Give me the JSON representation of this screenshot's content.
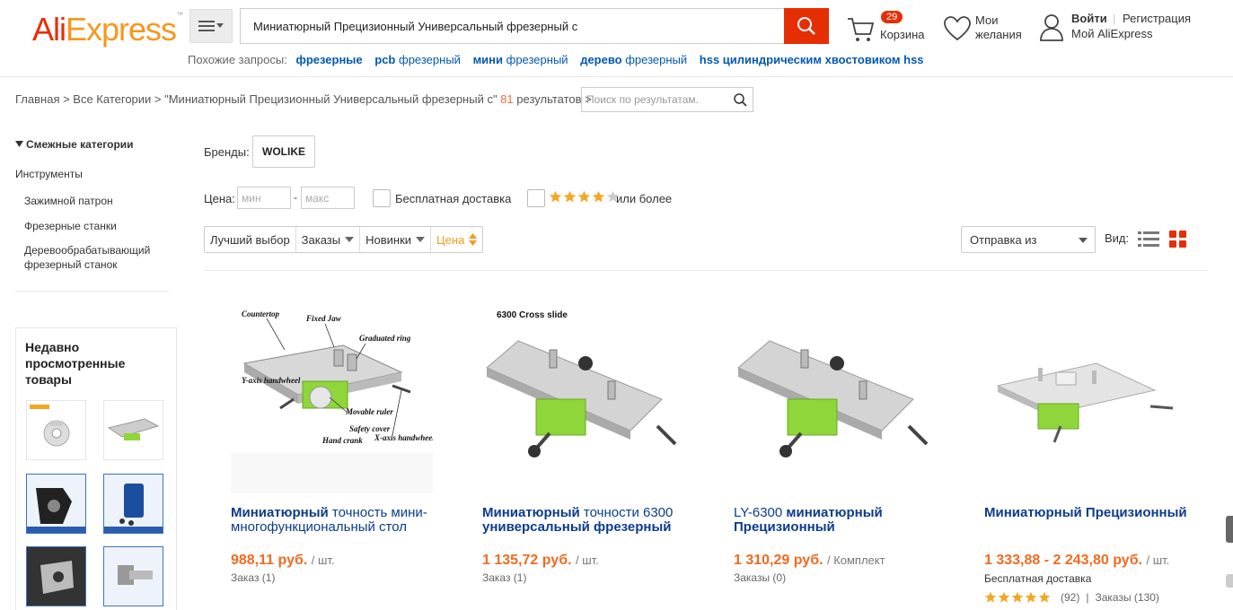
{
  "header": {
    "logo_part1": "Ali",
    "logo_part2": "Express",
    "search_query": "Миниатюрный Прецизионный Универсальный фрезерный с",
    "cart_count": "29",
    "cart_label": "Корзина",
    "wishlist_label": "Мои желания",
    "signin_label": "Войти",
    "register_label": "Регистрация",
    "my_account_label": "Мой AliExpress",
    "related_label": "Похожие запросы:",
    "related_queries": [
      {
        "bold": "фрезерные",
        "rest": ""
      },
      {
        "bold": "pcb",
        "rest": " фрезерный"
      },
      {
        "bold": "мини",
        "rest": " фрезерный"
      },
      {
        "bold": "дерево",
        "rest": " фрезерный"
      },
      {
        "bold": "hss цилиндрическим хвостовиком hss",
        "rest": ""
      }
    ]
  },
  "breadcrumb": {
    "path": "Главная > Все Категории > \"Миниатюрный Прецизионный Универсальный фрезерный с\"",
    "count": "81",
    "suffix": "результатов >",
    "search_placeholder": "Поиск по результатам."
  },
  "sidebar": {
    "title": "Смежные категории",
    "category": "Инструменты",
    "subcategories": [
      "Зажимной патрон",
      "Фрезерные станки",
      "Деревообрабатывающий фрезерный станок"
    ],
    "recent_title": "Недавно просмотренные товары"
  },
  "filters": {
    "brand_label": "Бренды:",
    "brand_chip": "WOLIKE",
    "price_label": "Цена:",
    "price_min_placeholder": "мин",
    "price_max_placeholder": "макс",
    "price_dash": "-",
    "free_shipping_label": "Бесплатная доставка",
    "rating_stars": 4,
    "rating_label": "или более",
    "sort": [
      "Лучший выбор",
      "Заказы",
      "Новинки",
      "Цена"
    ],
    "ship_from": "Отправка из",
    "view_label": "Вид:"
  },
  "products": [
    {
      "title_bold": "Миниатюрный",
      "title_rest": " точность мини-многофункциональный стол",
      "price": "988,11 руб.",
      "unit": "/ шт.",
      "orders": "Заказ (1)"
    },
    {
      "title_bold": "Миниатюрный",
      "title_rest": " точности 6300 ",
      "title_bold2": "универсальный фрезерный",
      "price": "1 135,72 руб.",
      "unit": "/ шт.",
      "orders": "Заказ (1)",
      "image_caption": "6300 Cross slide"
    },
    {
      "title_pre": "LY-6300 ",
      "title_bold": "миниатюрный Прецизионный",
      "price": "1 310,29 руб.",
      "unit": "/ Комплект",
      "orders": "Заказы (0)"
    },
    {
      "title_bold": "Миниатюрный Прецизионный",
      "price": "1 333,88 - 2 243,80 руб.",
      "unit": "/ шт.",
      "free_shipping": "Бесплатная доставка",
      "rating_stars": 5,
      "reviews": "(92)",
      "sep": "|",
      "orders": "Заказы (130)"
    }
  ],
  "product1_diagram_labels": [
    "Countertop",
    "Fixed Jaw",
    "Graduated ring",
    "Y-axis handwheel",
    "Movable ruler",
    "Safety cover",
    "Hand crank",
    "X-axis handwheel"
  ],
  "colors": {
    "brand_red": "#e62e04",
    "brand_orange": "#f7971d",
    "price": "#f26a21",
    "link": "#0b3c8c",
    "star": "#f5a623",
    "machine_green": "#8fd63a"
  }
}
